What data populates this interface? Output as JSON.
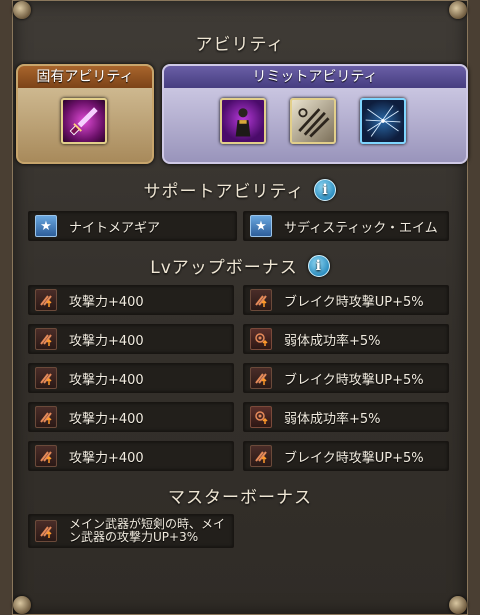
{
  "titles": {
    "abilities": "アビリティ",
    "support": "サポートアビリティ",
    "lv_bonus": "Lvアップボーナス",
    "master_bonus": "マスターボーナス"
  },
  "unique_panel": {
    "label": "固有アビリティ",
    "icons": [
      "dagger-ability-icon"
    ]
  },
  "limit_panel": {
    "label": "リミットアビリティ",
    "icons": [
      "dark-figure-ability-icon",
      "blades-ability-icon",
      "star-net-ability-icon"
    ]
  },
  "support_abilities": [
    {
      "label": "ナイトメアギア",
      "icon": "star-icon"
    },
    {
      "label": "サディスティック・エイム",
      "icon": "star-icon"
    }
  ],
  "lv_bonus": {
    "left": [
      {
        "label": "攻撃力+400",
        "icon": "attack-up-icon"
      },
      {
        "label": "攻撃力+400",
        "icon": "attack-up-icon"
      },
      {
        "label": "攻撃力+400",
        "icon": "attack-up-icon"
      },
      {
        "label": "攻撃力+400",
        "icon": "attack-up-icon"
      },
      {
        "label": "攻撃力+400",
        "icon": "attack-up-icon"
      }
    ],
    "right": [
      {
        "label": "ブレイク時攻撃UP+5%",
        "icon": "attack-up-icon"
      },
      {
        "label": "弱体成功率+5%",
        "icon": "debuff-up-icon"
      },
      {
        "label": "ブレイク時攻撃UP+5%",
        "icon": "attack-up-icon"
      },
      {
        "label": "弱体成功率+5%",
        "icon": "debuff-up-icon"
      },
      {
        "label": "ブレイク時攻撃UP+5%",
        "icon": "attack-up-icon"
      }
    ]
  },
  "master_bonus": [
    {
      "line1": "メイン武器が短剣の時、メイ",
      "line2": "ン武器の攻撃力UP+3%",
      "icon": "attack-up-icon"
    }
  ],
  "colors": {
    "unique_header": "#8f5020",
    "limit_header": "#574d92",
    "info": "#3a9ccc"
  }
}
